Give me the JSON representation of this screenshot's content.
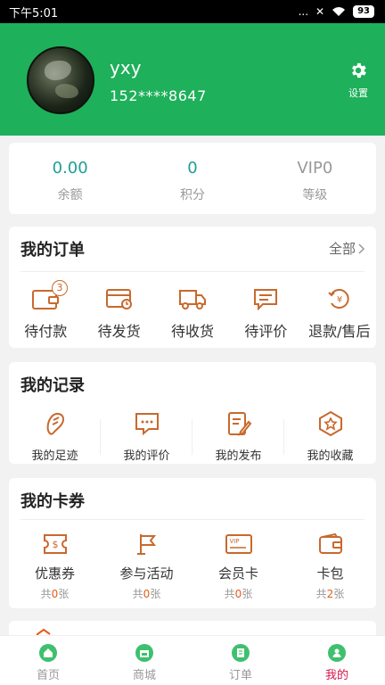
{
  "status_bar": {
    "time": "下午5:01",
    "signal": "...",
    "battery": "93"
  },
  "profile": {
    "username": "yxy",
    "phone": "152****8647",
    "settings_label": "设置"
  },
  "stats": [
    {
      "value": "0.00",
      "label": "余额"
    },
    {
      "value": "0",
      "label": "积分"
    },
    {
      "value": "VIP0",
      "label": "等级"
    }
  ],
  "orders": {
    "title": "我的订单",
    "all_label": "全部",
    "pending_payment_badge": "3",
    "items": [
      {
        "label": "待付款",
        "icon": "wallet-icon"
      },
      {
        "label": "待发货",
        "icon": "card-clock-icon"
      },
      {
        "label": "待收货",
        "icon": "truck-icon"
      },
      {
        "label": "待评价",
        "icon": "comment-icon"
      },
      {
        "label": "退款/售后",
        "icon": "refund-icon"
      }
    ]
  },
  "records": {
    "title": "我的记录",
    "items": [
      {
        "label": "我的足迹",
        "icon": "footprint-icon"
      },
      {
        "label": "我的评价",
        "icon": "chat-bubble-icon"
      },
      {
        "label": "我的发布",
        "icon": "edit-document-icon"
      },
      {
        "label": "我的收藏",
        "icon": "star-badge-icon"
      }
    ]
  },
  "coupons": {
    "title": "我的卡券",
    "items": [
      {
        "label": "优惠券",
        "prefix": "共",
        "count": "0",
        "suffix": "张",
        "icon": "coupon-icon"
      },
      {
        "label": "参与活动",
        "prefix": "共",
        "count": "0",
        "suffix": "张",
        "icon": "flag-icon"
      },
      {
        "label": "会员卡",
        "prefix": "共",
        "count": "0",
        "suffix": "张",
        "icon": "vip-card-icon"
      },
      {
        "label": "卡包",
        "prefix": "共",
        "count": "2",
        "suffix": "张",
        "icon": "card-wallet-icon"
      }
    ]
  },
  "tabs": [
    {
      "label": "首页",
      "icon": "home-icon",
      "color": "#3ec06f"
    },
    {
      "label": "商城",
      "icon": "shop-icon",
      "color": "#3ec06f"
    },
    {
      "label": "订单",
      "icon": "order-icon",
      "color": "#3ec06f"
    },
    {
      "label": "我的",
      "icon": "profile-icon",
      "color": "#3ec06f",
      "active": true
    }
  ],
  "colors": {
    "brand_green": "#1eb05a",
    "accent_teal": "#1f9e96",
    "icon_orange": "#c8692d",
    "active_tab": "#d6164d",
    "count_highlight": "#e65b1a"
  }
}
